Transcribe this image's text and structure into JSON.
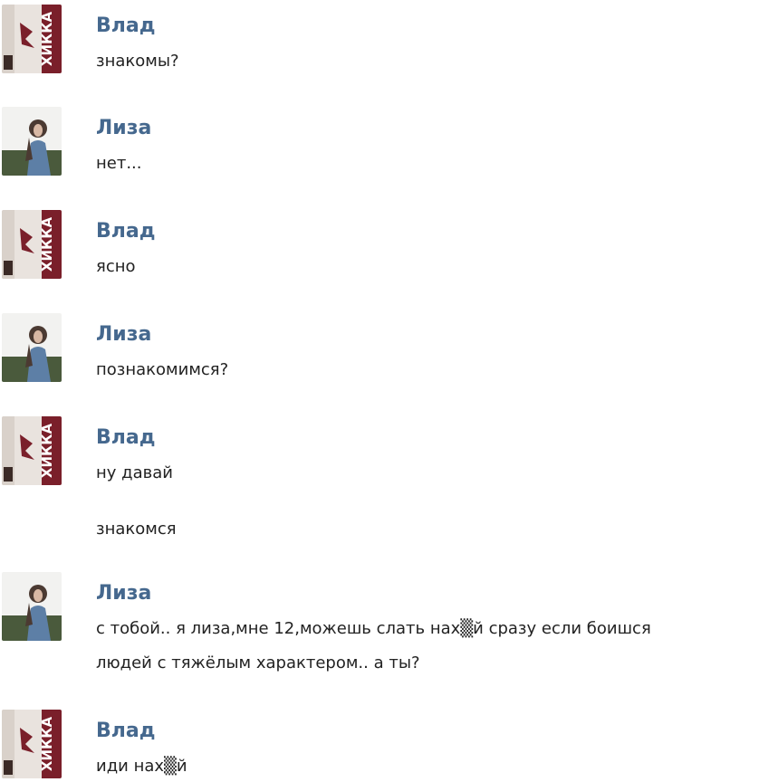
{
  "messages": [
    {
      "author": "Влад",
      "avatar_icon": "vlad-avatar-icon",
      "lines": [
        "знакомы?"
      ]
    },
    {
      "author": "Лиза",
      "avatar_icon": "liza-avatar-icon",
      "lines": [
        "нет..."
      ]
    },
    {
      "author": "Влад",
      "avatar_icon": "vlad-avatar-icon",
      "lines": [
        "ясно"
      ]
    },
    {
      "author": "Лиза",
      "avatar_icon": "liza-avatar-icon",
      "lines": [
        "познакомимся?"
      ]
    },
    {
      "author": "Влад",
      "avatar_icon": "vlad-avatar-icon",
      "lines": [
        "ну давай",
        "знакомся"
      ]
    },
    {
      "author": "Лиза",
      "avatar_icon": "liza-avatar-icon",
      "lines": [
        "с тобой.. я лиза,мне 12,можешь слать нах▒й сразу если боишся",
        "людей с тяжёлым характером.. а ты?"
      ]
    },
    {
      "author": "Влад",
      "avatar_icon": "vlad-avatar-icon",
      "lines": [
        "иди нах▒й"
      ]
    }
  ],
  "avatar_vlad": {
    "label": "ХИККА",
    "colors": {
      "bg": "#e9e3de",
      "accent": "#7a1f2a",
      "dark": "#3b2a26"
    }
  },
  "avatar_liza": {
    "colors": {
      "sky": "#f2f2f0",
      "grass": "#4a5a3c",
      "hair": "#4b3a32",
      "dress": "#5d7fa6"
    }
  }
}
